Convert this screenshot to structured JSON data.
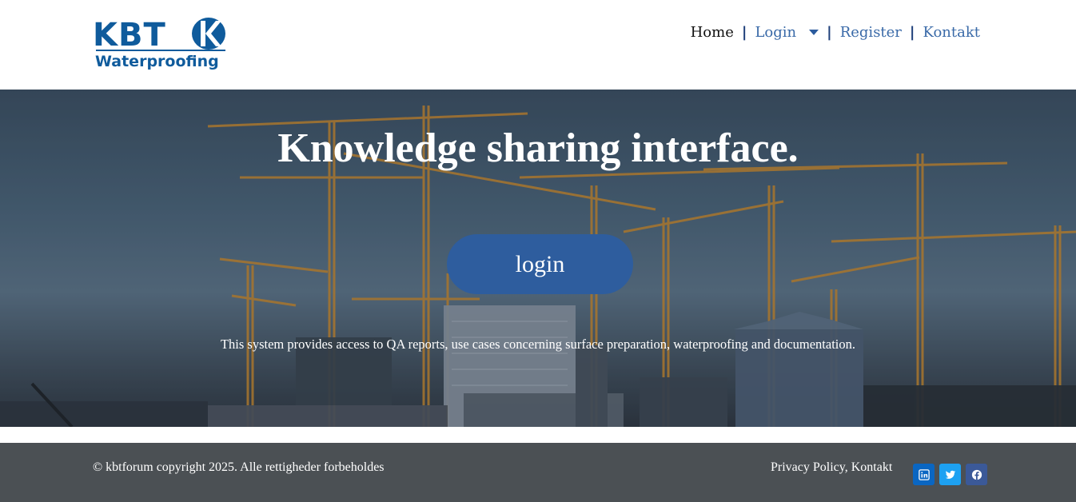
{
  "header": {
    "logo": {
      "top_text": "KBT",
      "bottom_text": "Waterproofing",
      "brand_color": "#0f5b9c"
    },
    "nav": [
      {
        "label": "Home",
        "active": true
      },
      {
        "label": "Login",
        "has_dropdown": true
      },
      {
        "label": "Register"
      },
      {
        "label": "Kontakt"
      }
    ],
    "separator": "|"
  },
  "hero": {
    "title": "Knowledge sharing interface.",
    "button_label": "login",
    "description": "This system provides access to QA reports, use cases concerning surface preparation, waterproofing and documentation.",
    "button_color": "#2e5d9e"
  },
  "footer": {
    "copyright": "© kbtforum copyright 2025. Alle rettigheder forbeholdes",
    "links": {
      "privacy": "Privacy Policy",
      "sep": ", ",
      "contact": "Kontakt"
    },
    "social": [
      {
        "icon": "linkedin-icon",
        "color": "#0a66c2"
      },
      {
        "icon": "twitter-icon",
        "color": "#1da1f2"
      },
      {
        "icon": "facebook-icon",
        "color": "#3b5998"
      }
    ],
    "background": "#4b5054"
  }
}
